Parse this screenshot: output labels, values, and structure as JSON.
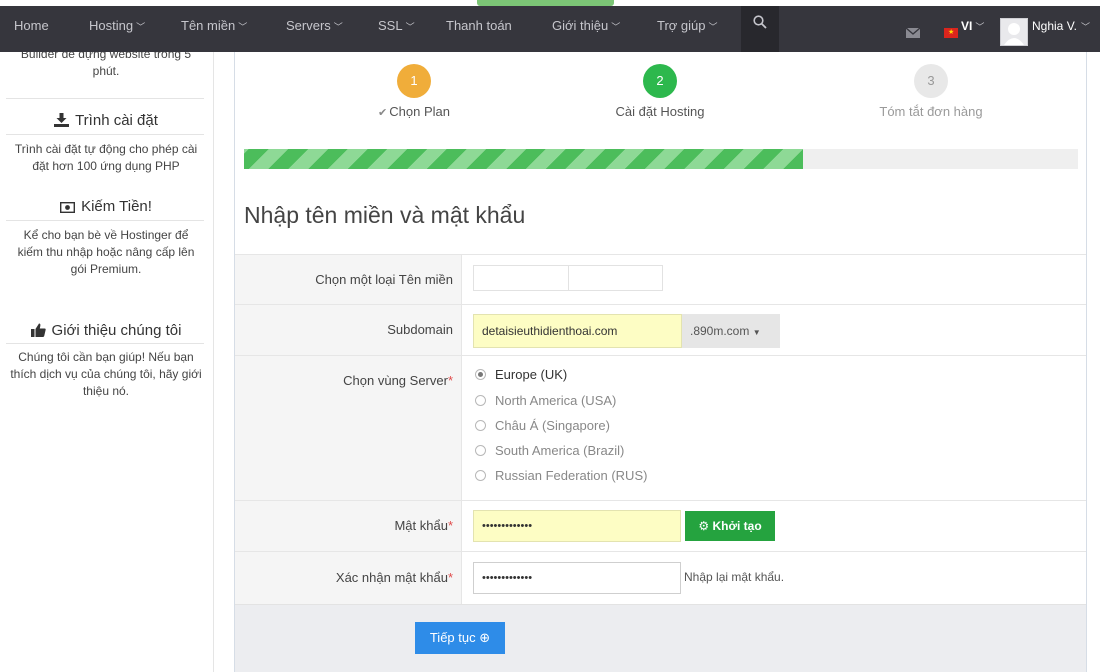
{
  "nav": {
    "items": [
      {
        "label": "Home",
        "chevron": false
      },
      {
        "label": "Hosting",
        "chevron": true
      },
      {
        "label": "Tên miền",
        "chevron": true
      },
      {
        "label": "Servers",
        "chevron": true
      },
      {
        "label": "SSL",
        "chevron": true
      },
      {
        "label": "Thanh toán",
        "chevron": false
      },
      {
        "label": "Giới thiệu",
        "chevron": true
      },
      {
        "label": "Trợ giúp",
        "chevron": true
      }
    ],
    "lang": "VI",
    "user": "Nghia V.",
    "icons": [
      "search-icon",
      "mail-icon",
      "vietnam-flag-icon",
      "user-avatar-icon"
    ]
  },
  "sidebar": {
    "intro_text": "Builder để dựng website trong 5 phút.",
    "sections": [
      {
        "title": "Trình cài đặt",
        "icon": "download-icon",
        "desc": "Trình cài đặt tự động cho phép cài đặt hơn 100 ứng dụng PHP"
      },
      {
        "title": "Kiếm Tiền!",
        "icon": "money-icon",
        "desc": "Kể cho bạn bè về Hostinger để kiếm thu nhập hoặc nâng cấp lên gói Premium."
      },
      {
        "title": "Giới thiệu chúng tôi",
        "icon": "thumbs-up-icon",
        "desc": "Chúng tôi cần bạn giúp! Nếu bạn thích dịch vụ của chúng tôi, hãy giới thiệu nó."
      }
    ]
  },
  "steps": [
    {
      "number": "1",
      "label": "Chọn Plan",
      "state": "done"
    },
    {
      "number": "2",
      "label": "Cài đặt Hosting",
      "state": "active"
    },
    {
      "number": "3",
      "label": "Tóm tắt đơn hàng",
      "state": "pending"
    }
  ],
  "progress": {
    "fraction": 0.67,
    "color": "#4cbd5b"
  },
  "form": {
    "title": "Nhập tên miền và mật khẩu",
    "domain_type_label": "Chọn một loại Tên miền",
    "subdomain_label": "Subdomain",
    "subdomain_value": "detaisieuthidienthoai.com",
    "subdomain_suffix": ".890m.com",
    "server_label": "Chọn vùng Server",
    "server_options": [
      {
        "label": "Europe (UK)",
        "checked": true
      },
      {
        "label": "North America (USA)",
        "checked": false
      },
      {
        "label": "Châu Á (Singapore)",
        "checked": false
      },
      {
        "label": "South America (Brazil)",
        "checked": false
      },
      {
        "label": "Russian Federation (RUS)",
        "checked": false
      }
    ],
    "password_label": "Mật khẩu",
    "password_value": "•••••••••••••",
    "generate_button": "Khởi tạo",
    "confirm_label": "Xác nhận mật khẩu",
    "confirm_value": "•••••••••••••",
    "confirm_hint": "Nhập lại mật khẩu.",
    "required_mark": "*",
    "continue_button": "Tiếp tục"
  },
  "colors": {
    "navbar": "#36363d",
    "step1": "#f0ad3a",
    "step2": "#2db84d",
    "generate": "#25a33f",
    "continue": "#2e8ce8",
    "input_highlight": "#fdfdc4"
  }
}
